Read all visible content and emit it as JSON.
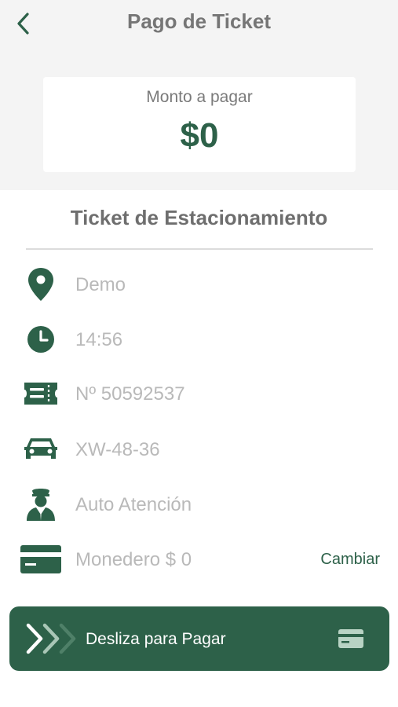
{
  "header": {
    "title": "Pago de Ticket",
    "back_icon": "chevron-left-icon"
  },
  "amount": {
    "label": "Monto a pagar",
    "value": "$0"
  },
  "ticket": {
    "section_title": "Ticket de Estacionamiento",
    "rows": [
      {
        "icon": "location-pin-icon",
        "text": "Demo"
      },
      {
        "icon": "clock-icon",
        "text": "14:56"
      },
      {
        "icon": "ticket-icon",
        "text": "Nº 50592537"
      },
      {
        "icon": "car-icon",
        "text": "XW-48-36"
      },
      {
        "icon": "attendant-icon",
        "text": "Auto Atención"
      },
      {
        "icon": "credit-card-icon",
        "text": "Monedero $ 0"
      }
    ],
    "change_label": "Cambiar"
  },
  "slider": {
    "label": "Desliza para Pagar",
    "icon": "credit-card-icon"
  },
  "colors": {
    "brand_green": "#2d6149",
    "header_bg": "#f4f4f4",
    "muted_text": "#b9b9b9"
  }
}
